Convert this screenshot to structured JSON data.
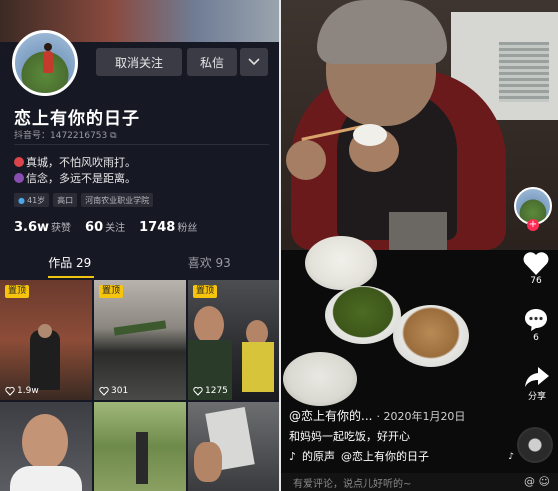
{
  "profile": {
    "follow_label": "取消关注",
    "message_label": "私信",
    "more_icon": "chevron-down-icon",
    "nickname": "恋上有你的日子",
    "uid": "抖音号：1472216753",
    "bio_line1": "真城，不怕风吹雨打。",
    "bio_line2": "信念，多远不是距离。",
    "tags": [
      "41岁",
      "高口",
      "河南农业职业学院"
    ],
    "likes_value": "3.6w",
    "likes_label": "获赞",
    "following_value": "60",
    "following_label": "关注",
    "fans_value": "1748",
    "fans_label": "粉丝"
  },
  "tabs": [
    {
      "label": "作品 29"
    },
    {
      "label": "喜欢 93"
    }
  ],
  "grid": [
    {
      "pinned": "置顶",
      "likes": "1.9w"
    },
    {
      "pinned": "置顶",
      "likes": "301"
    },
    {
      "pinned": "置顶",
      "likes": "1275"
    },
    {
      "pinned": "",
      "likes": ""
    },
    {
      "pinned": "",
      "likes": ""
    },
    {
      "pinned": "",
      "likes": ""
    }
  ],
  "video": {
    "author": "@恋上有你的...",
    "date": "· 2020年1月20日",
    "caption": "和妈妈一起吃饭，好开心",
    "music_prefix": "的原声",
    "music_author": "@恋上有你的日子",
    "like_count": "76",
    "comment_count": "6",
    "share_label": "分享",
    "comment_placeholder": "有爱评论，说点儿好听的~",
    "plus": "+"
  },
  "colors": {
    "accent": "#f1c40f",
    "pin_bg": "#f6c40d",
    "like_red": "#fe2c55",
    "panel_bg": "#161823"
  }
}
